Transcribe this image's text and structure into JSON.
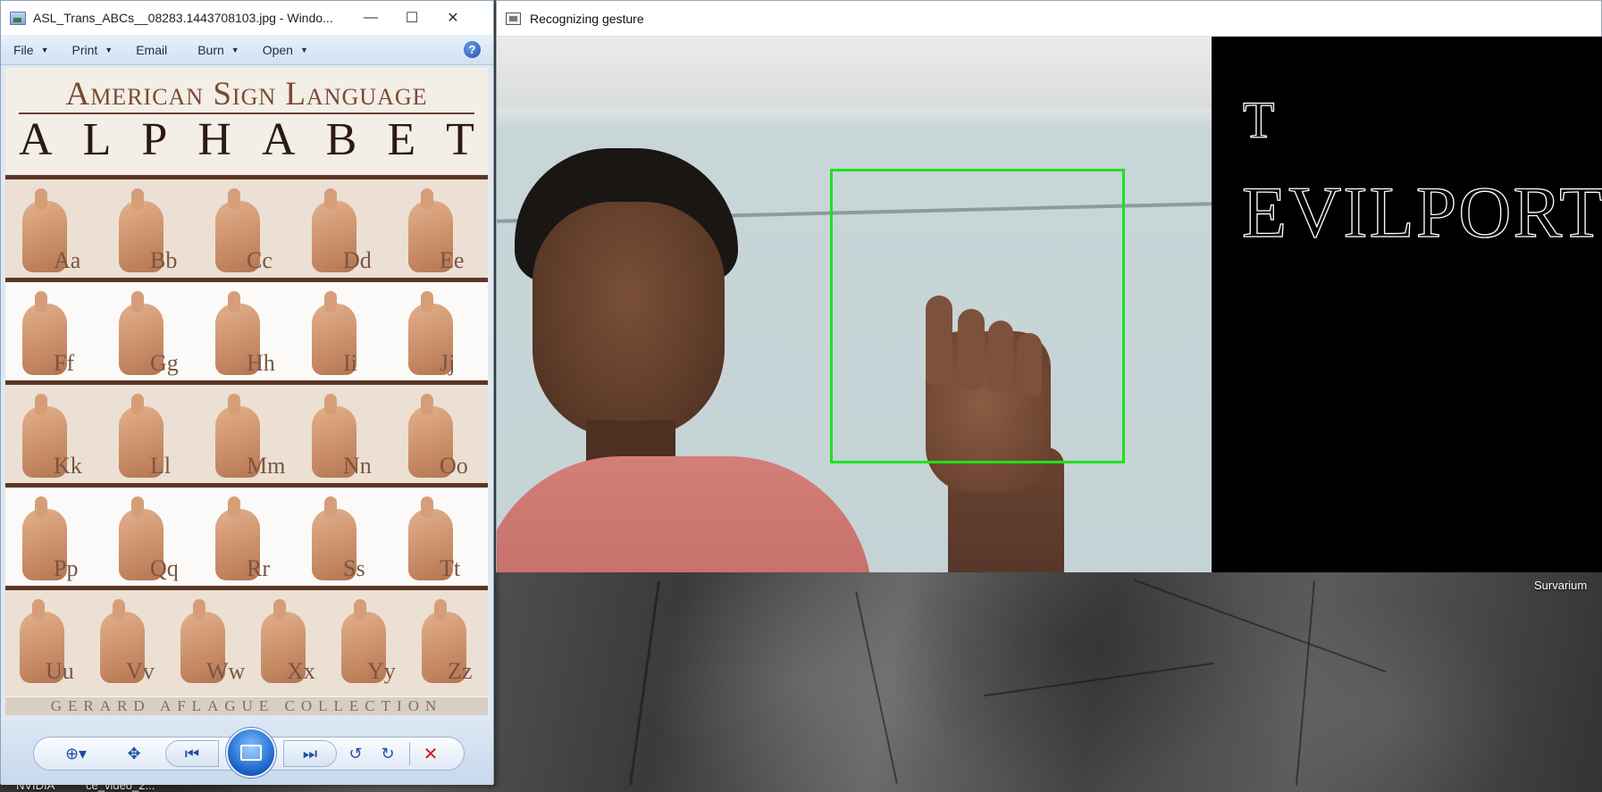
{
  "viewer": {
    "title": "ASL_Trans_ABCs__08283.1443708103.jpg - Windo...",
    "menu": [
      "File",
      "Print",
      "Email",
      "Burn",
      "Open"
    ],
    "poster": {
      "heading": "American Sign Language",
      "alphabet": "ALPHABET",
      "rows": [
        [
          "Aa",
          "Bb",
          "Cc",
          "Dd",
          "Ee"
        ],
        [
          "Ff",
          "Gg",
          "Hh",
          "Ii",
          "Jj"
        ],
        [
          "Kk",
          "Ll",
          "Mm",
          "Nn",
          "Oo"
        ],
        [
          "Pp",
          "Qq",
          "Rr",
          "Ss",
          "Tt"
        ],
        [
          "Uu",
          "Vv",
          "Ww",
          "Xx",
          "Yy",
          "Zz"
        ]
      ],
      "footer": "GERARD AFLAGUE COLLECTION"
    }
  },
  "gesture_window": {
    "title": "Recognizing gesture",
    "predicted_letter": "T",
    "recognized_text": "EVILPORT",
    "roi_color": "#1de21d"
  },
  "desktop": {
    "labels": {
      "survarium": "Survarium",
      "nvidia": "NVIDIA",
      "video": "ce_video_2..."
    }
  }
}
